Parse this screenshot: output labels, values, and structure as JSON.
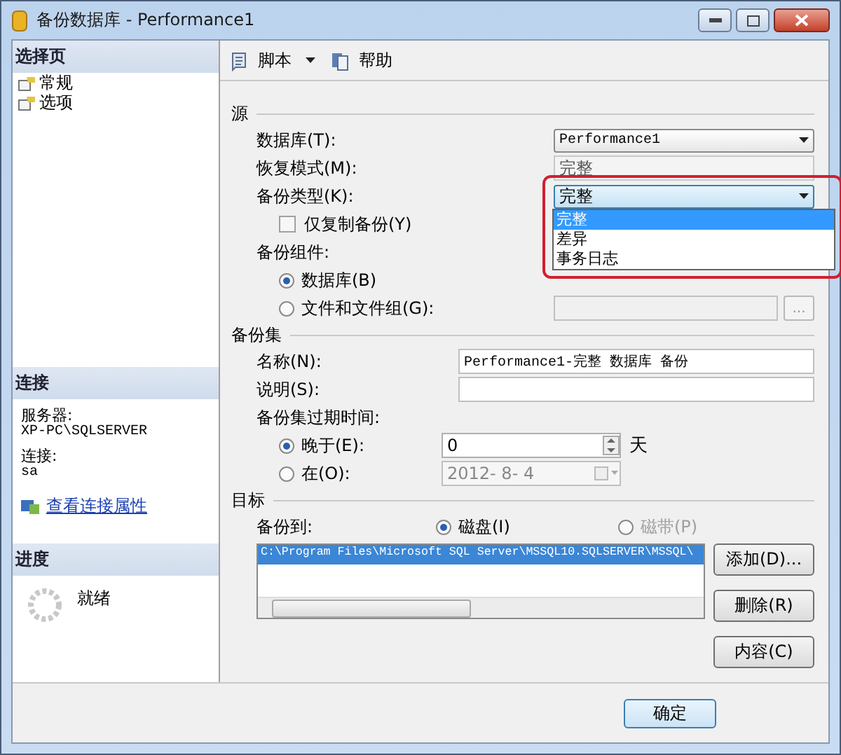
{
  "window": {
    "title": "备份数据库 - Performance1"
  },
  "sidebar": {
    "pages_header": "选择页",
    "pages": [
      {
        "label": "常规",
        "selected": false
      },
      {
        "label": "选项",
        "selected": false
      }
    ],
    "connection_header": "连接",
    "server_label": "服务器:",
    "server": "XP-PC\\SQLSERVER",
    "connect_label": "连接:",
    "user": "sa",
    "link": "查看连接属性",
    "progress_header": "进度",
    "status": "就绪"
  },
  "toolbar": {
    "items": [
      {
        "kind": "script",
        "label": "脚本"
      },
      {
        "kind": "help",
        "label": "帮助"
      }
    ]
  },
  "source": {
    "header": "源",
    "database_label": "数据库(T):",
    "database": "Performance1",
    "recovery_label": "恢复模式(M):",
    "recovery": "完整",
    "type_label": "备份类型(K):",
    "type": "完整",
    "type_options": [
      {
        "label": "完整",
        "selected": true
      },
      {
        "label": "差异",
        "selected": false
      },
      {
        "label": "事务日志",
        "selected": false
      }
    ],
    "copy_only": {
      "label": "仅复制备份(Y)",
      "checked": false
    },
    "component_label": "备份组件:",
    "components": [
      {
        "label": "数据库(B)",
        "selected": true
      },
      {
        "label": "文件和文件组(G):",
        "selected": false
      }
    ],
    "browse": "..."
  },
  "backup_set": {
    "header": "备份集",
    "name_label": "名称(N):",
    "name": "Performance1-完整 数据库 备份",
    "desc_label": "说明(S):",
    "expire_label": "备份集过期时间:",
    "expire_after": {
      "label": "晚于(E):",
      "selected": true,
      "value": "0",
      "unit": "天"
    },
    "expire_on": {
      "label": "在(O):",
      "selected": false,
      "value": "2012- 8- 4"
    }
  },
  "destination": {
    "header": "目标",
    "to_label": "备份到:",
    "media": [
      {
        "label": "磁盘(I)",
        "selected": true,
        "disabled": false
      },
      {
        "label": "磁带(P)",
        "selected": false,
        "disabled": true
      }
    ],
    "paths": [
      {
        "text": "C:\\Program Files\\Microsoft SQL Server\\MSSQL10.SQLSERVER\\MSSQL\\",
        "selected": true
      }
    ],
    "buttons": [
      "添加(D)...",
      "删除(R)",
      "内容(C)"
    ]
  },
  "footer": {
    "ok": "确定"
  }
}
